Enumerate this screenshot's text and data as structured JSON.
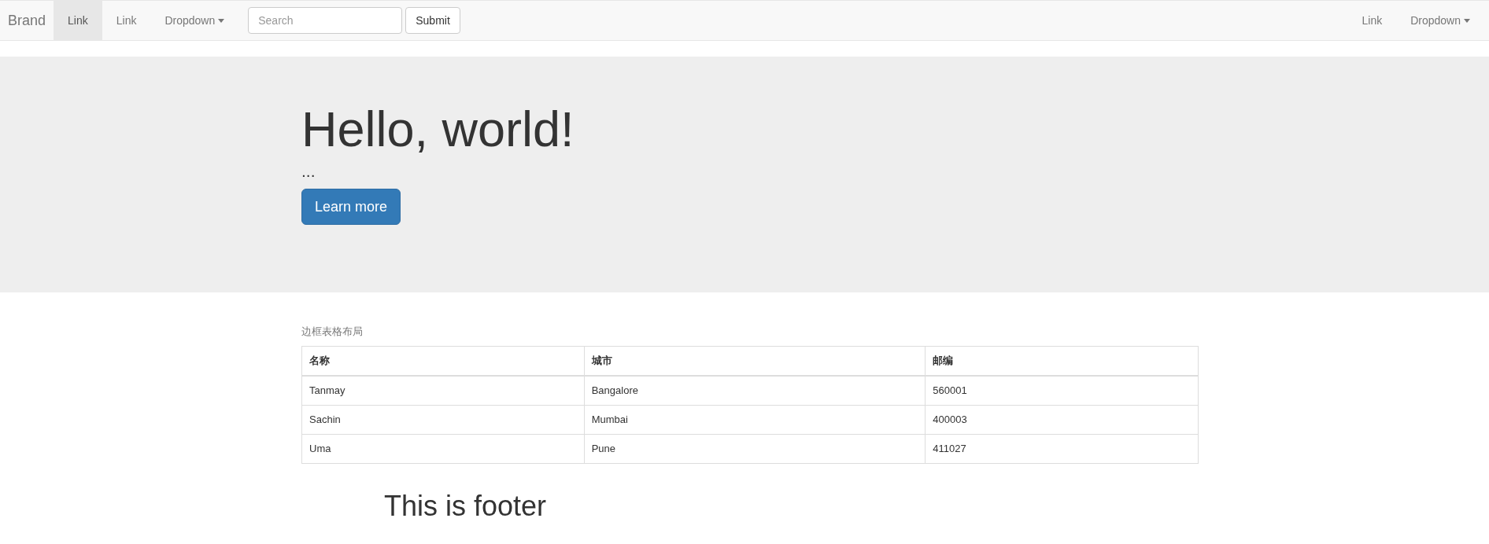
{
  "navbar": {
    "brand": "Brand",
    "left_items": [
      {
        "kind": "link",
        "label": "Link",
        "selected": true
      },
      {
        "kind": "link",
        "label": "Link",
        "selected": false
      },
      {
        "kind": "dropdown",
        "label": "Dropdown",
        "selected": false
      }
    ],
    "search": {
      "placeholder": "Search"
    },
    "submit": "Submit",
    "right_items": [
      {
        "kind": "link",
        "label": "Link",
        "selected": false
      },
      {
        "kind": "dropdown",
        "label": "Dropdown",
        "selected": false
      }
    ]
  },
  "jumbotron": {
    "title": "Hello, world!",
    "text": "...",
    "button": "Learn more"
  },
  "table": {
    "caption": "边框表格布局",
    "columns": [
      "名称",
      "城市",
      "邮编"
    ],
    "rows": [
      [
        "Tanmay",
        "Bangalore",
        "560001"
      ],
      [
        "Sachin",
        "Mumbai",
        "400003"
      ],
      [
        "Uma",
        "Pune",
        "411027"
      ]
    ]
  },
  "footer": "This is footer"
}
